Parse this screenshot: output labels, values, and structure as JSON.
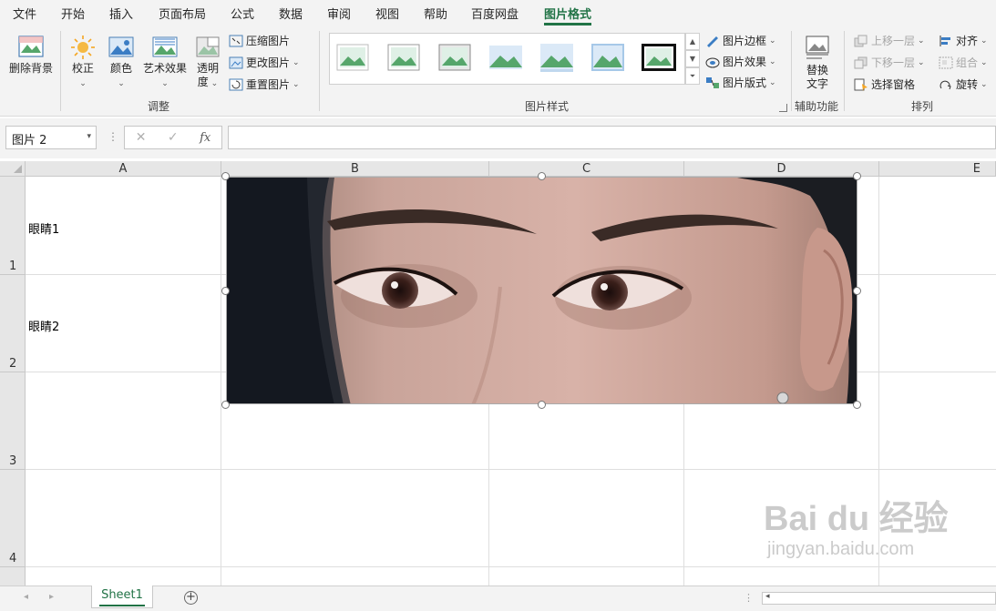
{
  "menu": {
    "tabs": [
      "文件",
      "开始",
      "插入",
      "页面布局",
      "公式",
      "数据",
      "审阅",
      "视图",
      "帮助",
      "百度网盘",
      "图片格式"
    ],
    "active": "图片格式"
  },
  "ribbon": {
    "remove_bg": "删除背景",
    "corrections": "校正",
    "color": "颜色",
    "artistic": "艺术效果",
    "transparency_1": "透明",
    "transparency_2": "度",
    "compress": "压缩图片",
    "change": "更改图片",
    "reset": "重置图片",
    "group_adjust": "调整",
    "group_styles": "图片样式",
    "border": "图片边框",
    "effects": "图片效果",
    "layout": "图片版式",
    "alt_text_1": "替换",
    "alt_text_2": "文字",
    "group_access": "辅助功能",
    "bring_forward": "上移一层",
    "send_backward": "下移一层",
    "selection_pane": "选择窗格",
    "align": "对齐",
    "group_obj": "组合",
    "rotate": "旋转",
    "group_arrange": "排列"
  },
  "formula_bar": {
    "name_box": "图片 2",
    "fx": "fx",
    "formula": ""
  },
  "sheet": {
    "columns": [
      "A",
      "B",
      "C",
      "D",
      "E"
    ],
    "rows": [
      "1",
      "2",
      "3",
      "4"
    ],
    "cells": {
      "A1": "眼睛1",
      "A2": "眼睛2"
    }
  },
  "tabs": {
    "sheet1": "Sheet1"
  },
  "watermark": {
    "logo": "Bai du 经验",
    "url": "jingyan.baidu.com"
  },
  "colors": {
    "accent": "#217346"
  }
}
